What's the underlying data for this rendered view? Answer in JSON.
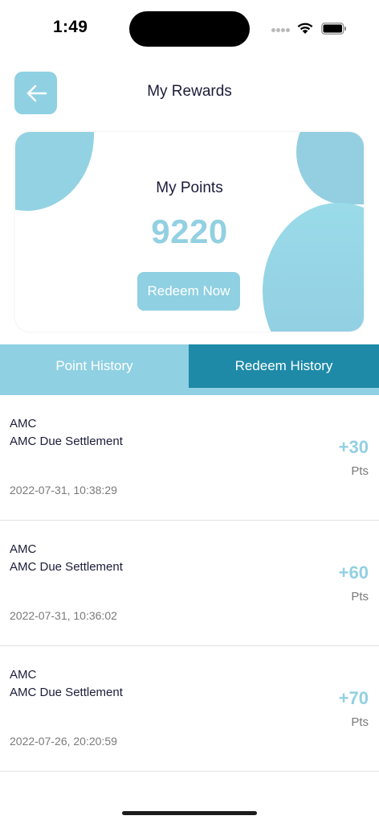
{
  "status_bar": {
    "time": "1:49"
  },
  "header": {
    "title": "My Rewards"
  },
  "points_card": {
    "label": "My Points",
    "value": "9220",
    "redeem_label": "Redeem Now"
  },
  "tabs": [
    {
      "label": "Point History",
      "active": false
    },
    {
      "label": "Redeem History",
      "active": true
    }
  ],
  "history": [
    {
      "category": "AMC",
      "description": "AMC Due Settlement",
      "points": "+30",
      "unit": "Pts",
      "date": "2022-07-31, 10:38:29"
    },
    {
      "category": "AMC",
      "description": "AMC Due Settlement",
      "points": "+60",
      "unit": "Pts",
      "date": "2022-07-31, 10:36:02"
    },
    {
      "category": "AMC",
      "description": "AMC Due Settlement",
      "points": "+70",
      "unit": "Pts",
      "date": "2022-07-26, 20:20:59"
    }
  ],
  "icons": {
    "back": "arrow-left-icon",
    "wifi": "wifi-icon",
    "battery": "battery-icon",
    "signal": "signal-dots-icon"
  },
  "colors": {
    "accent": "#8fd0e2",
    "accent_dark": "#1e8aa8",
    "points_text": "#92d0e2",
    "text_primary": "#1c1c3a",
    "text_muted": "#7a7a7a"
  }
}
